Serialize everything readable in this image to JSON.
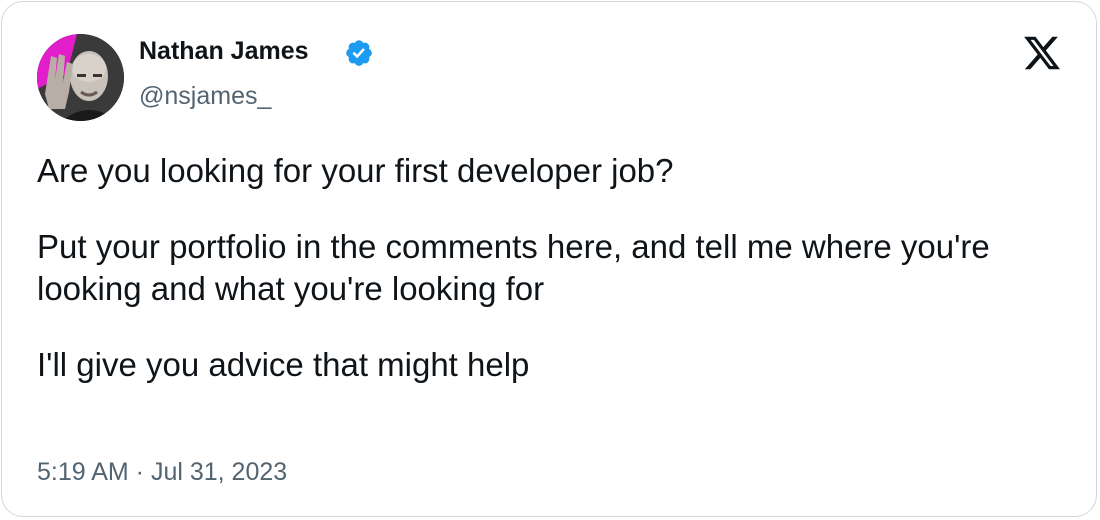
{
  "author": {
    "display_name": "Nathan James",
    "handle": "@nsjames_",
    "verified": true,
    "avatar_icon": "profile-photo-waving",
    "verified_color": "#1d9bf0"
  },
  "brand": {
    "logo_icon": "x-logo-icon",
    "logo_color": "#0f1419"
  },
  "tweet": {
    "paragraphs": [
      "Are you looking for your first developer job?",
      "Put your portfolio in the comments here, and tell me where you're looking and what you're looking for",
      "I'll give you advice that might help"
    ],
    "timestamp": "5:19 AM · Jul 31, 2023"
  },
  "colors": {
    "text": "#0f1419",
    "secondary_text": "#536471",
    "border": "#cfd9de"
  }
}
